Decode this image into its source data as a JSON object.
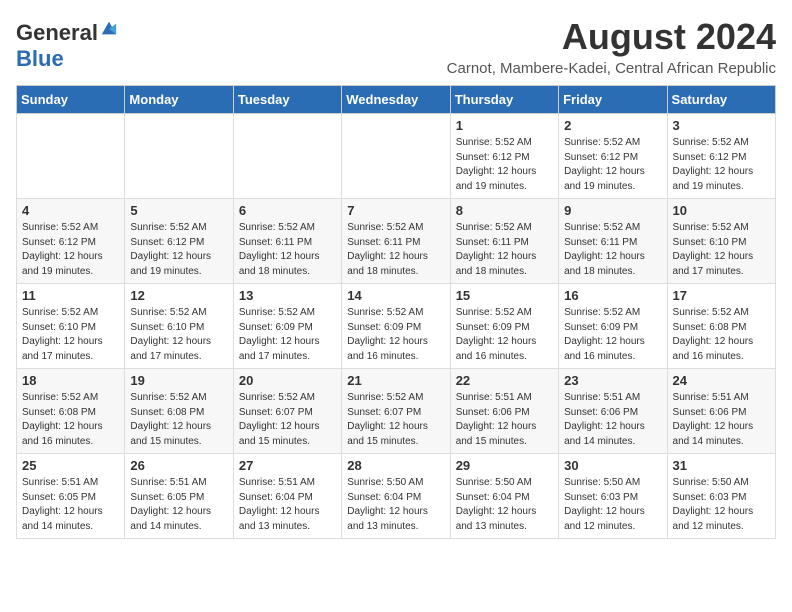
{
  "logo": {
    "general": "General",
    "blue": "Blue"
  },
  "title": "August 2024",
  "subtitle": "Carnot, Mambere-Kadei, Central African Republic",
  "days_of_week": [
    "Sunday",
    "Monday",
    "Tuesday",
    "Wednesday",
    "Thursday",
    "Friday",
    "Saturday"
  ],
  "weeks": [
    [
      {
        "day": "",
        "info": ""
      },
      {
        "day": "",
        "info": ""
      },
      {
        "day": "",
        "info": ""
      },
      {
        "day": "",
        "info": ""
      },
      {
        "day": "1",
        "info": "Sunrise: 5:52 AM\nSunset: 6:12 PM\nDaylight: 12 hours\nand 19 minutes."
      },
      {
        "day": "2",
        "info": "Sunrise: 5:52 AM\nSunset: 6:12 PM\nDaylight: 12 hours\nand 19 minutes."
      },
      {
        "day": "3",
        "info": "Sunrise: 5:52 AM\nSunset: 6:12 PM\nDaylight: 12 hours\nand 19 minutes."
      }
    ],
    [
      {
        "day": "4",
        "info": "Sunrise: 5:52 AM\nSunset: 6:12 PM\nDaylight: 12 hours\nand 19 minutes."
      },
      {
        "day": "5",
        "info": "Sunrise: 5:52 AM\nSunset: 6:12 PM\nDaylight: 12 hours\nand 19 minutes."
      },
      {
        "day": "6",
        "info": "Sunrise: 5:52 AM\nSunset: 6:11 PM\nDaylight: 12 hours\nand 18 minutes."
      },
      {
        "day": "7",
        "info": "Sunrise: 5:52 AM\nSunset: 6:11 PM\nDaylight: 12 hours\nand 18 minutes."
      },
      {
        "day": "8",
        "info": "Sunrise: 5:52 AM\nSunset: 6:11 PM\nDaylight: 12 hours\nand 18 minutes."
      },
      {
        "day": "9",
        "info": "Sunrise: 5:52 AM\nSunset: 6:11 PM\nDaylight: 12 hours\nand 18 minutes."
      },
      {
        "day": "10",
        "info": "Sunrise: 5:52 AM\nSunset: 6:10 PM\nDaylight: 12 hours\nand 17 minutes."
      }
    ],
    [
      {
        "day": "11",
        "info": "Sunrise: 5:52 AM\nSunset: 6:10 PM\nDaylight: 12 hours\nand 17 minutes."
      },
      {
        "day": "12",
        "info": "Sunrise: 5:52 AM\nSunset: 6:10 PM\nDaylight: 12 hours\nand 17 minutes."
      },
      {
        "day": "13",
        "info": "Sunrise: 5:52 AM\nSunset: 6:09 PM\nDaylight: 12 hours\nand 17 minutes."
      },
      {
        "day": "14",
        "info": "Sunrise: 5:52 AM\nSunset: 6:09 PM\nDaylight: 12 hours\nand 16 minutes."
      },
      {
        "day": "15",
        "info": "Sunrise: 5:52 AM\nSunset: 6:09 PM\nDaylight: 12 hours\nand 16 minutes."
      },
      {
        "day": "16",
        "info": "Sunrise: 5:52 AM\nSunset: 6:09 PM\nDaylight: 12 hours\nand 16 minutes."
      },
      {
        "day": "17",
        "info": "Sunrise: 5:52 AM\nSunset: 6:08 PM\nDaylight: 12 hours\nand 16 minutes."
      }
    ],
    [
      {
        "day": "18",
        "info": "Sunrise: 5:52 AM\nSunset: 6:08 PM\nDaylight: 12 hours\nand 16 minutes."
      },
      {
        "day": "19",
        "info": "Sunrise: 5:52 AM\nSunset: 6:08 PM\nDaylight: 12 hours\nand 15 minutes."
      },
      {
        "day": "20",
        "info": "Sunrise: 5:52 AM\nSunset: 6:07 PM\nDaylight: 12 hours\nand 15 minutes."
      },
      {
        "day": "21",
        "info": "Sunrise: 5:52 AM\nSunset: 6:07 PM\nDaylight: 12 hours\nand 15 minutes."
      },
      {
        "day": "22",
        "info": "Sunrise: 5:51 AM\nSunset: 6:06 PM\nDaylight: 12 hours\nand 15 minutes."
      },
      {
        "day": "23",
        "info": "Sunrise: 5:51 AM\nSunset: 6:06 PM\nDaylight: 12 hours\nand 14 minutes."
      },
      {
        "day": "24",
        "info": "Sunrise: 5:51 AM\nSunset: 6:06 PM\nDaylight: 12 hours\nand 14 minutes."
      }
    ],
    [
      {
        "day": "25",
        "info": "Sunrise: 5:51 AM\nSunset: 6:05 PM\nDaylight: 12 hours\nand 14 minutes."
      },
      {
        "day": "26",
        "info": "Sunrise: 5:51 AM\nSunset: 6:05 PM\nDaylight: 12 hours\nand 14 minutes."
      },
      {
        "day": "27",
        "info": "Sunrise: 5:51 AM\nSunset: 6:04 PM\nDaylight: 12 hours\nand 13 minutes."
      },
      {
        "day": "28",
        "info": "Sunrise: 5:50 AM\nSunset: 6:04 PM\nDaylight: 12 hours\nand 13 minutes."
      },
      {
        "day": "29",
        "info": "Sunrise: 5:50 AM\nSunset: 6:04 PM\nDaylight: 12 hours\nand 13 minutes."
      },
      {
        "day": "30",
        "info": "Sunrise: 5:50 AM\nSunset: 6:03 PM\nDaylight: 12 hours\nand 12 minutes."
      },
      {
        "day": "31",
        "info": "Sunrise: 5:50 AM\nSunset: 6:03 PM\nDaylight: 12 hours\nand 12 minutes."
      }
    ]
  ]
}
